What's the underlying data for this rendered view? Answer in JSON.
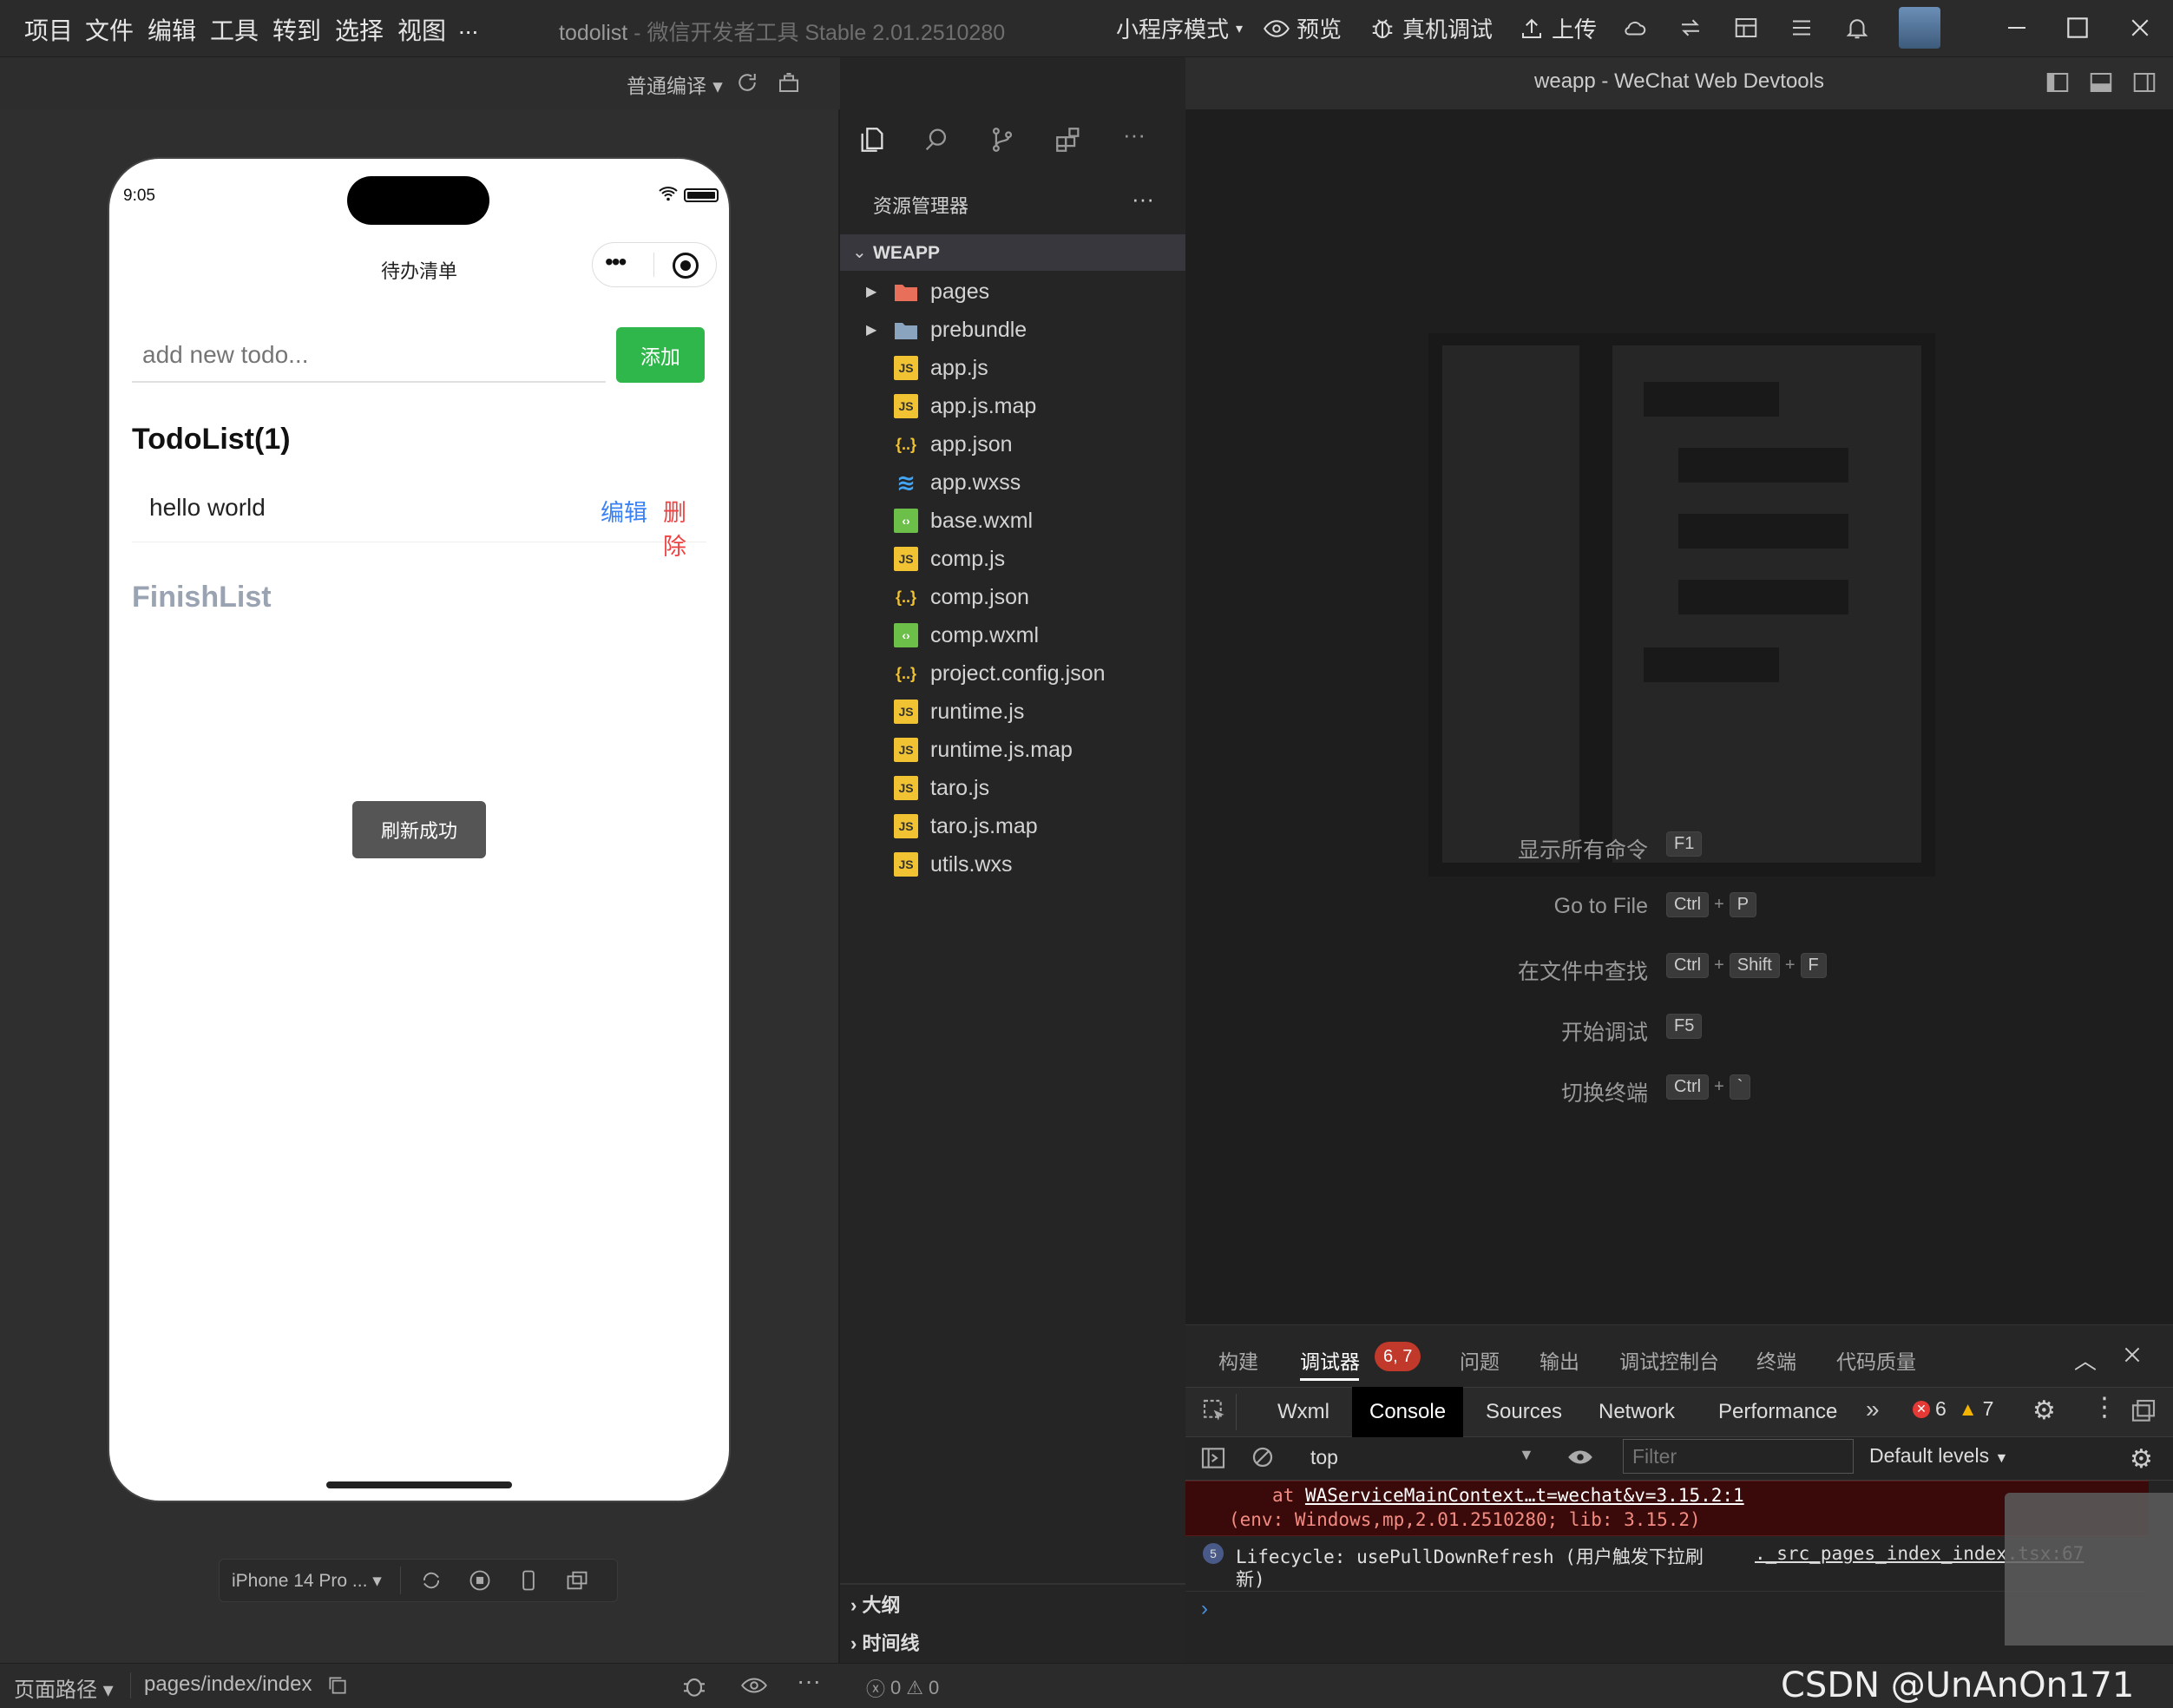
{
  "menu": [
    "项目",
    "文件",
    "编辑",
    "工具",
    "转到",
    "选择",
    "视图",
    "..."
  ],
  "window_title": {
    "app": "todolist",
    "sep": " - ",
    "product": "微信开发者工具 Stable 2.01.2510280"
  },
  "toolbar": {
    "mode": "小程序模式",
    "preview": "预览",
    "real_debug": "真机调试",
    "upload": "上传"
  },
  "sim_toolbar": {
    "compile": "普通编译"
  },
  "phone": {
    "time": "9:05",
    "nav_title": "待办清单",
    "input_placeholder": "add new todo...",
    "add_label": "添加",
    "todo_heading": "TodoList(1)",
    "todos": [
      {
        "text": "hello world",
        "edit": "编辑",
        "delete": "删除"
      }
    ],
    "finish_heading": "FinishList",
    "toast": "刷新成功"
  },
  "device": {
    "name": "iPhone 14 Pro ..."
  },
  "bottombar": {
    "route_label": "页面路径",
    "route": "pages/index/index",
    "errors": "0",
    "warnings": "0"
  },
  "editor_title": "weapp - WeChat Web Devtools",
  "explorer": {
    "title": "资源管理器",
    "root": "WEAPP",
    "items": [
      {
        "name": "pages",
        "type": "folder-pages"
      },
      {
        "name": "prebundle",
        "type": "folder"
      },
      {
        "name": "app.js",
        "type": "js"
      },
      {
        "name": "app.js.map",
        "type": "map"
      },
      {
        "name": "app.json",
        "type": "json"
      },
      {
        "name": "app.wxss",
        "type": "css"
      },
      {
        "name": "base.wxml",
        "type": "wxml"
      },
      {
        "name": "comp.js",
        "type": "js"
      },
      {
        "name": "comp.json",
        "type": "json"
      },
      {
        "name": "comp.wxml",
        "type": "wxml"
      },
      {
        "name": "project.config.json",
        "type": "json"
      },
      {
        "name": "runtime.js",
        "type": "js"
      },
      {
        "name": "runtime.js.map",
        "type": "map"
      },
      {
        "name": "taro.js",
        "type": "js"
      },
      {
        "name": "taro.js.map",
        "type": "map"
      },
      {
        "name": "utils.wxs",
        "type": "js"
      }
    ],
    "outline": "大纲",
    "timeline": "时间线"
  },
  "shortcuts": [
    {
      "label": "显示所有命令",
      "keys": [
        "F1"
      ]
    },
    {
      "label": "Go to File",
      "keys": [
        "Ctrl",
        "P"
      ]
    },
    {
      "label": "在文件中查找",
      "keys": [
        "Ctrl",
        "Shift",
        "F"
      ]
    },
    {
      "label": "开始调试",
      "keys": [
        "F5"
      ]
    },
    {
      "label": "切换终端",
      "keys": [
        "Ctrl",
        "`"
      ]
    }
  ],
  "debug_tabs": [
    "构建",
    "调试器",
    "问题",
    "输出",
    "调试控制台",
    "终端",
    "代码质量"
  ],
  "debug_badge": "6, 7",
  "devtools_tabs": [
    "Wxml",
    "Console",
    "Sources",
    "Network",
    "Performance"
  ],
  "devtools_counts": {
    "errors": "6",
    "warnings": "7"
  },
  "console": {
    "context": "top",
    "filter_placeholder": "Filter",
    "levels": "Default levels",
    "error_at": "at ",
    "error_link": "WAServiceMainContext…t=wechat&v=3.15.2:1",
    "error_env": "(env: Windows,mp,2.01.2510280; lib: 3.15.2)",
    "log_count": "5",
    "log_text": "Lifecycle: usePullDownRefresh (用户触发下拉刷",
    "log_text2": "新)",
    "log_link": "._src_pages_index_index.tsx:67"
  },
  "watermark": "CSDN @UnAnOn171"
}
